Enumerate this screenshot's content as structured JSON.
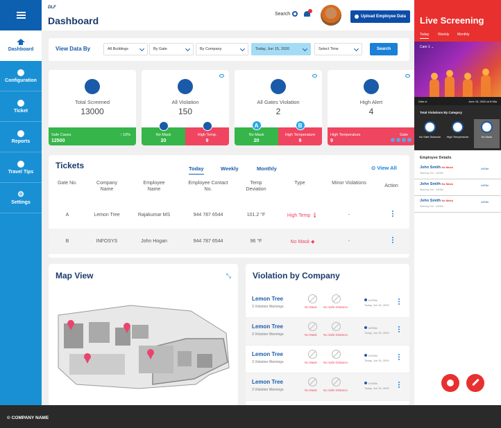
{
  "header": {
    "brand": "DLF",
    "title": "Dashboard",
    "search_label": "Search",
    "upload_label": "Upload Employee Data"
  },
  "filters": {
    "label": "View Data By",
    "building": "All Buildings",
    "gate": "By Gate",
    "company": "By Company",
    "date": "Today, Jun 15, 2020",
    "time": "Select Time",
    "search_btn": "Search"
  },
  "sidebar": {
    "items": [
      {
        "label": "Dashboard",
        "icon": "home-icon"
      },
      {
        "label": "Configuration",
        "icon": "circle-icon"
      },
      {
        "label": "Ticket",
        "icon": "circle-icon"
      },
      {
        "label": "Reports",
        "icon": "circle-icon"
      },
      {
        "label": "Travel Tips",
        "icon": "circle-icon"
      },
      {
        "label": "Settings",
        "icon": "gear-icon"
      }
    ]
  },
  "stats": {
    "screened": {
      "label": "Total Screened",
      "value": "13000",
      "foot_label": "Safe Cases",
      "foot_value": "12500",
      "trend": "↑ 10%"
    },
    "violation": {
      "label": "All Violation",
      "value": "150",
      "left_label": "No Mask",
      "left_value": "20",
      "right_label": "High Temp.",
      "right_value": "9"
    },
    "gates": {
      "label": "All Gates Violation",
      "value": "2",
      "badge_a": "A",
      "badge_b": "B",
      "left_label": "No Mask",
      "left_value": "20",
      "right_label": "High Temperature",
      "right_value": "9"
    },
    "alert": {
      "label": "High Alert",
      "value": "4",
      "left_label": "High Temperature",
      "left_value": "9",
      "right_label": "Gate"
    }
  },
  "tickets": {
    "title": "Tickets",
    "tabs": [
      "Today",
      "Weekly",
      "Monthly"
    ],
    "view_all": "View All",
    "headers": [
      "Gate No.",
      "Company Name",
      "Employee Name",
      "Employee Contact No.",
      "Temp Deviation",
      "Type",
      "Minor Violations",
      "Action"
    ],
    "rows": [
      {
        "gate": "A",
        "company": "Lemon Tree",
        "employee": "Rajakumar MS",
        "contact": "944 787 6544",
        "temp": "101.2 °F",
        "type": "High Temp",
        "minor": "-"
      },
      {
        "gate": "B",
        "company": "INFOSYS",
        "employee": "John Hogan",
        "contact": "944 787 6544",
        "temp": "96 °F",
        "type": "No Mask",
        "minor": "-"
      }
    ]
  },
  "map": {
    "title": "Map View"
  },
  "violation_by_company": {
    "title": "Violation by Company",
    "rows": [
      {
        "name": "Lemon Tree",
        "sub": "3 Violation Warnings",
        "b1": "No Mask",
        "b2": "No Safe Distance",
        "meta1": "InSSite",
        "meta2": "Today, Jun 15, 2020"
      },
      {
        "name": "Lemon Tree",
        "sub": "3 Violation Warnings",
        "b1": "No Mask",
        "b2": "No Safe Distance",
        "meta1": "InSSite",
        "meta2": "Today, Jun 15, 2020"
      },
      {
        "name": "Lemon Tree",
        "sub": "3 Violation Warnings",
        "b1": "No Mask",
        "b2": "No Safe Distance",
        "meta1": "InSSite",
        "meta2": "Today, Jun 15, 2020"
      },
      {
        "name": "Lemon Tree",
        "sub": "3 Violation Warnings",
        "b1": "No Mask",
        "b2": "No Safe Distance",
        "meta1": "InSSite",
        "meta2": "Today, Jun 15, 2020"
      }
    ]
  },
  "live": {
    "title": "Live Screening",
    "tabs": [
      "Today",
      "Weekly",
      "Monthly"
    ],
    "cam": "Cam 1",
    "gate": "Gate A",
    "datetime": "June 15, 2020 at 9:08a",
    "cat_label": "Total Violations By Category",
    "categories": [
      "No Safe Distance",
      "High Temperature",
      "No Mask"
    ],
    "emp_title": "Employee Details",
    "employees": [
      {
        "name": "John Smith",
        "tag": "No Mask",
        "sub": "Warning 2nd · InSSite",
        "r": "InSSite"
      },
      {
        "name": "John Smith",
        "tag": "No Mask",
        "sub": "Warning 2nd · InSSite",
        "r": "InSSite"
      },
      {
        "name": "John Smith",
        "tag": "No Mask",
        "sub": "Warning 2nd · InSSite",
        "r": "InSSite"
      }
    ]
  },
  "footer": {
    "text": "© COMPANY NAME"
  },
  "colors": {
    "primary": "#1a90d4",
    "dark_blue": "#1a3a6b",
    "red": "#e8302e",
    "green": "#36b54a",
    "pink": "#ef4560"
  }
}
